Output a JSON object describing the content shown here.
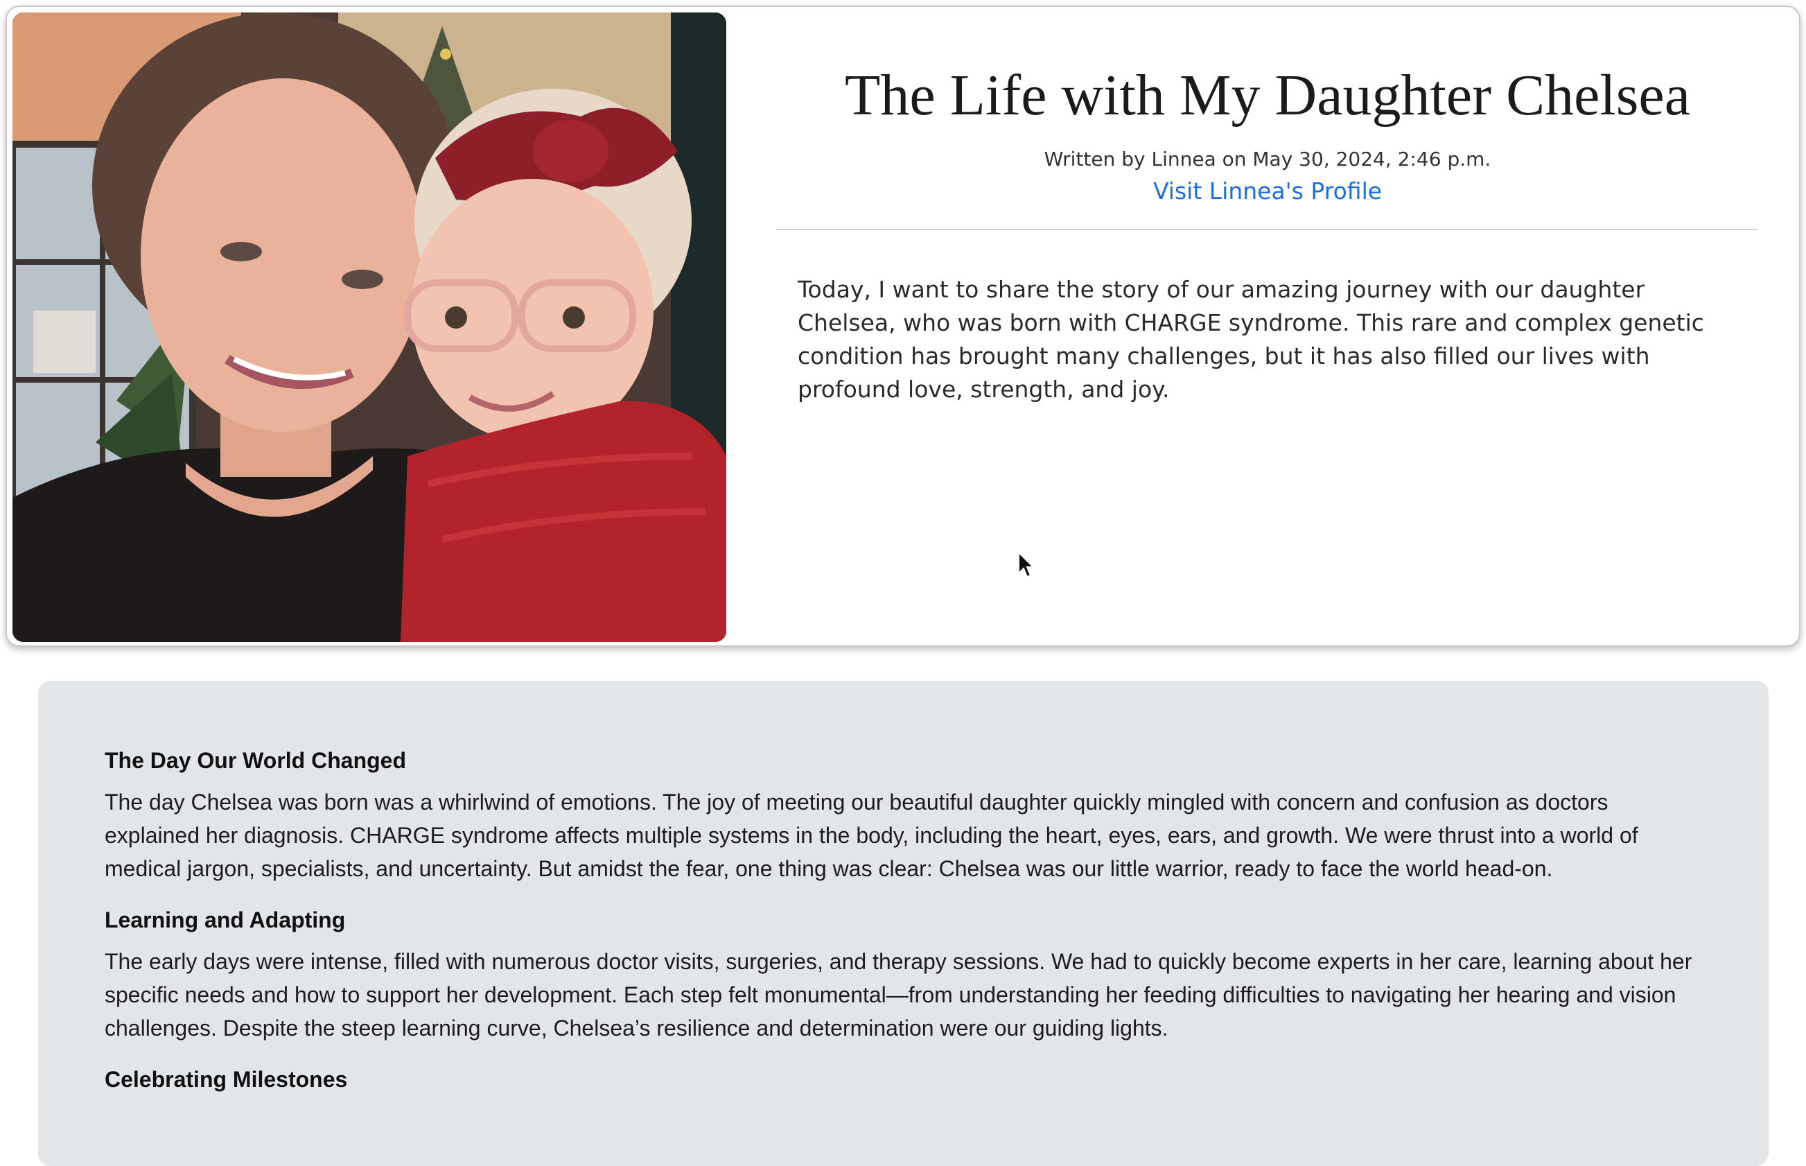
{
  "post": {
    "title": "The Life with My Daughter Chelsea",
    "byline": "Written by Linnea on May 30, 2024, 2:46 p.m.",
    "profile_link": "Visit Linnea's Profile",
    "intro": "Today, I want to share the story of our amazing journey with our daughter Chelsea, who was born with CHARGE syndrome. This rare and complex genetic condition has brought many challenges, but it has also filled our lives with profound love, strength, and joy."
  },
  "photo": {
    "subject": "mother-and-daughter-photo"
  },
  "sections": [
    {
      "heading": "The Day Our World Changed",
      "body": "The day Chelsea was born was a whirlwind of emotions. The joy of meeting our beautiful daughter quickly mingled with concern and confusion as doctors explained her diagnosis. CHARGE syndrome affects multiple systems in the body, including the heart, eyes, ears, and growth. We were thrust into a world of medical jargon, specialists, and uncertainty. But amidst the fear, one thing was clear: Chelsea was our little warrior, ready to face the world head-on."
    },
    {
      "heading": "Learning and Adapting",
      "body": "The early days were intense, filled with numerous doctor visits, surgeries, and therapy sessions. We had to quickly become experts in her care, learning about her specific needs and how to support her development. Each step felt monumental—from understanding her feeding difficulties to navigating her hearing and vision challenges. Despite the steep learning curve, Chelsea’s resilience and determination were our guiding lights."
    },
    {
      "heading": "Celebrating Milestones",
      "body": ""
    }
  ],
  "colors": {
    "link": "#1a6ee0",
    "story_background": "#e2e6e9",
    "card_border": "#c9c9c9"
  }
}
